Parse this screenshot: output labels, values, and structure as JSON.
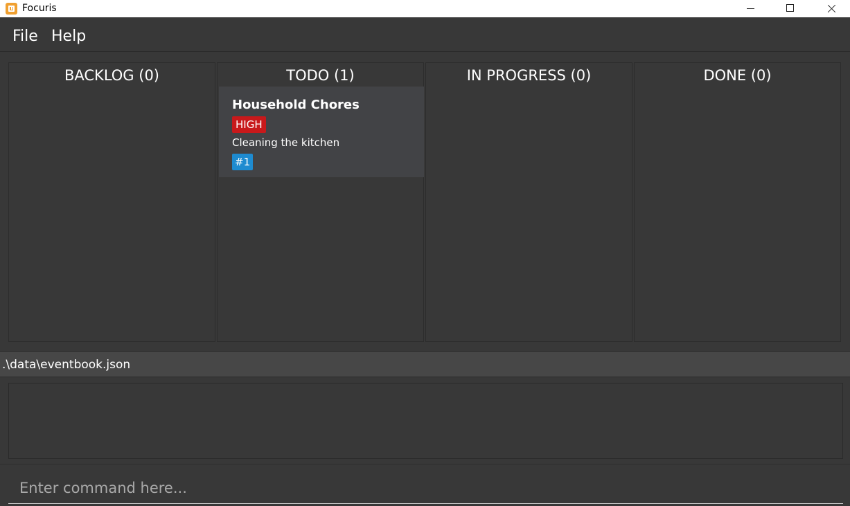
{
  "window": {
    "title": "Focuris"
  },
  "menu": {
    "file": "File",
    "help": "Help"
  },
  "columns": [
    {
      "label": "BACKLOG (0)"
    },
    {
      "label": "TODO (1)"
    },
    {
      "label": "IN PROGRESS (0)"
    },
    {
      "label": "DONE (0)"
    }
  ],
  "todo_card": {
    "title": "Household Chores",
    "priority": "HIGH",
    "description": "Cleaning the kitchen",
    "id": "#1"
  },
  "status": {
    "path": ".\\data\\eventbook.json"
  },
  "result": {
    "text": ""
  },
  "command": {
    "placeholder": "Enter command here...",
    "value": ""
  },
  "colors": {
    "background": "#383838",
    "card": "#424346",
    "priority_high": "#c8191b",
    "id_badge": "#1e8bd0",
    "app_icon": "#f0a030"
  }
}
